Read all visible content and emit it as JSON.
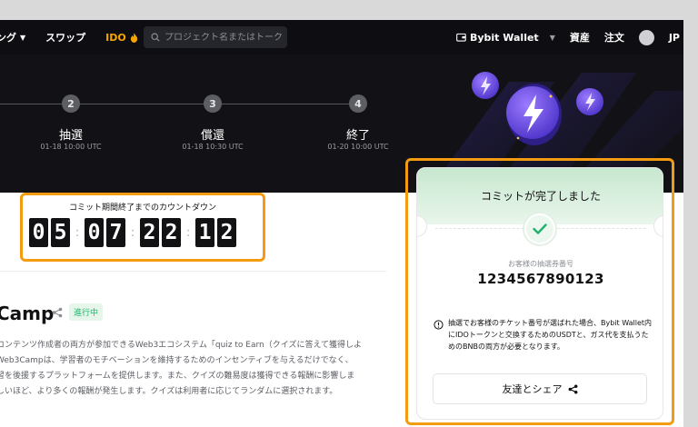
{
  "nav": {
    "trading_label": "ング",
    "swap_label": "スワップ",
    "ido_label": "IDO",
    "search_placeholder": "プロジェクト名またはトークンを",
    "wallet_label": "Bybit Wallet",
    "assets_label": "資産",
    "orders_label": "注文",
    "lang_label": "JP"
  },
  "steps": [
    {
      "num": "2",
      "label": "抽選",
      "date": "01-18 10:00 UTC"
    },
    {
      "num": "3",
      "label": "償還",
      "date": "01-18 10:30 UTC"
    },
    {
      "num": "4",
      "label": "終了",
      "date": "01-20 10:00 UTC"
    }
  ],
  "countdown": {
    "title": "コミット期間終了までのカウントダウン",
    "digits": [
      "0",
      "5",
      "0",
      "7",
      "2",
      "2",
      "1",
      "2"
    ]
  },
  "project": {
    "title": "Camp",
    "status": "進行中",
    "description": [
      "コンテンツ作成者の両方が参加できるWeb3エコシステム「quiz to Earn（クイズに答えて獲得しよ",
      "Web3Campは、学習者のモチベーションを維持するためのインセンティブを与えるだけでなく、",
      "習を後援するプラットフォームを提供します。また、クイズの難易度は獲得できる報酬に影響しま",
      "しいほど、より多くの報酬が発生します。クイズは利用者に応じてランダムに選択されます。"
    ]
  },
  "card": {
    "title": "コミットが完了しました",
    "ticket_label": "お客様の抽選券番号",
    "ticket_number": "1234567890123",
    "info": "抽選でお客様のチケット番号が選ばれた場合、Bybit Wallet内にIDOトークンと交換するためのUSDTと、ガス代を支払うためのBNBの両方が必要となります。",
    "share_label": "友達とシェア"
  },
  "colors": {
    "accent_orange": "#f39c12",
    "ido_orange": "#f7a600",
    "success_green": "#20b26c"
  }
}
